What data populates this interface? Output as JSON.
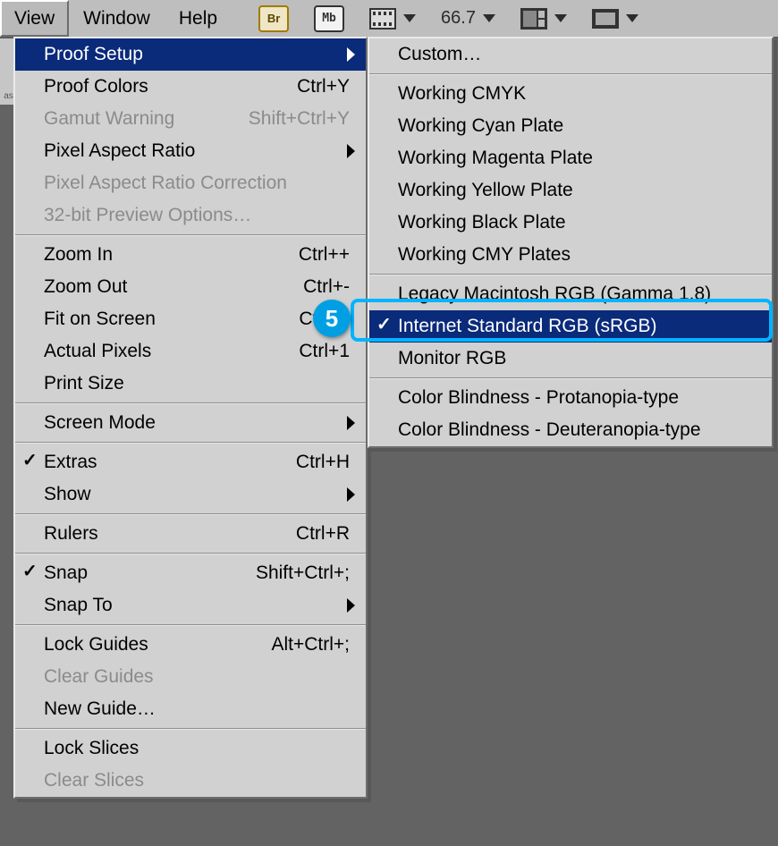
{
  "menubar": {
    "view": "View",
    "window": "Window",
    "help": "Help",
    "zoom": "66.7"
  },
  "toolbar": {
    "br": "Br",
    "mb": "Mb"
  },
  "view_menu": {
    "proof_setup": "Proof Setup",
    "proof_colors": {
      "label": "Proof Colors",
      "shortcut": "Ctrl+Y"
    },
    "gamut_warning": {
      "label": "Gamut Warning",
      "shortcut": "Shift+Ctrl+Y"
    },
    "pixel_aspect_ratio": "Pixel Aspect Ratio",
    "par_correction": "Pixel Aspect Ratio Correction",
    "preview32": "32-bit Preview Options…",
    "zoom_in": {
      "label": "Zoom In",
      "shortcut": "Ctrl++"
    },
    "zoom_out": {
      "label": "Zoom Out",
      "shortcut": "Ctrl+-"
    },
    "fit_on_screen": {
      "label": "Fit on Screen",
      "shortcut": "Ctrl+0"
    },
    "actual_pixels": {
      "label": "Actual Pixels",
      "shortcut": "Ctrl+1"
    },
    "print_size": "Print Size",
    "screen_mode": "Screen Mode",
    "extras": {
      "label": "Extras",
      "shortcut": "Ctrl+H"
    },
    "show": "Show",
    "rulers": {
      "label": "Rulers",
      "shortcut": "Ctrl+R"
    },
    "snap": {
      "label": "Snap",
      "shortcut": "Shift+Ctrl+;"
    },
    "snap_to": "Snap To",
    "lock_guides": {
      "label": "Lock Guides",
      "shortcut": "Alt+Ctrl+;"
    },
    "clear_guides": "Clear Guides",
    "new_guide": "New Guide…",
    "lock_slices": "Lock Slices",
    "clear_slices": "Clear Slices"
  },
  "proof_setup_menu": {
    "custom": "Custom…",
    "working_cmyk": "Working CMYK",
    "cyan": "Working Cyan Plate",
    "magenta": "Working Magenta Plate",
    "yellow": "Working Yellow Plate",
    "black": "Working Black Plate",
    "cmy": "Working CMY Plates",
    "legacy_mac": "Legacy Macintosh RGB (Gamma 1.8)",
    "srgb": "Internet Standard RGB (sRGB)",
    "monitor": "Monitor RGB",
    "protanopia": "Color Blindness - Protanopia-type",
    "deuteranopia": "Color Blindness - Deuteranopia-type"
  },
  "callout": {
    "number": "5"
  },
  "sidebar": {
    "fragment": "as"
  }
}
